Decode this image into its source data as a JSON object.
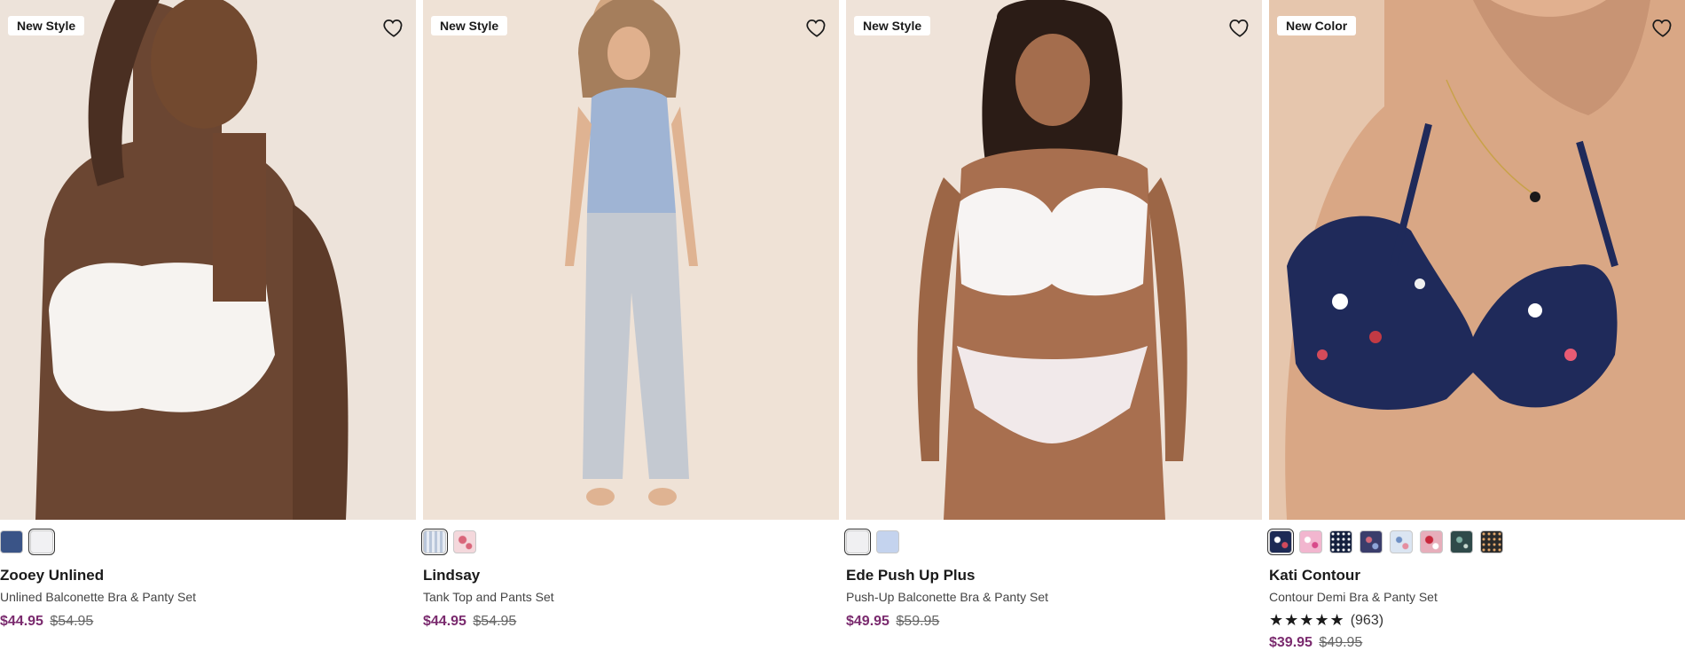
{
  "products": [
    {
      "badge": "New Style",
      "name": "Zooey Unlined",
      "description": "Unlined Balconette Bra & Panty Set",
      "sale_price": "$44.95",
      "original_price": "$54.95",
      "swatches": [
        {
          "name": "navy-heather",
          "color": "#3a5487",
          "selected": false
        },
        {
          "name": "white",
          "color": "#f1f1f3",
          "selected": true
        }
      ],
      "rating": null
    },
    {
      "badge": "New Style",
      "name": "Lindsay",
      "description": "Tank Top and Pants Set",
      "sale_price": "$44.95",
      "original_price": "$54.95",
      "swatches": [
        {
          "name": "blue-stripe",
          "color": "#b9c6da",
          "selected": true
        },
        {
          "name": "pink-floral",
          "color": "#f4d8dc",
          "selected": false
        }
      ],
      "rating": null
    },
    {
      "badge": "New Style",
      "name": "Ede Push Up Plus",
      "description": "Push-Up Balconette Bra & Panty Set",
      "sale_price": "$49.95",
      "original_price": "$59.95",
      "swatches": [
        {
          "name": "white",
          "color": "#f0f0f2",
          "selected": true
        },
        {
          "name": "light-blue",
          "color": "#c4d3ee",
          "selected": false
        }
      ],
      "rating": null
    },
    {
      "badge": "New Color",
      "name": "Kati Contour",
      "description": "Contour Demi Bra & Panty Set",
      "sale_price": "$39.95",
      "original_price": "$49.95",
      "swatches": [
        {
          "name": "navy-floral",
          "color": "#1d2a55",
          "selected": true
        },
        {
          "name": "pink-floral",
          "color": "#f2b6cf",
          "selected": false
        },
        {
          "name": "navy-dot",
          "color": "#14203e",
          "selected": false
        },
        {
          "name": "navy-print",
          "color": "#3a3d6b",
          "selected": false
        },
        {
          "name": "light-floral",
          "color": "#dbe5f2",
          "selected": false
        },
        {
          "name": "rose-floral",
          "color": "#e7aebb",
          "selected": false
        },
        {
          "name": "green-print",
          "color": "#2f4a4a",
          "selected": false
        },
        {
          "name": "black-dot",
          "color": "#2a2a2a",
          "selected": false
        }
      ],
      "rating": {
        "stars": "★★★★★",
        "count": "(963)"
      }
    }
  ],
  "icons": {
    "wishlist": "heart-outline-icon"
  }
}
